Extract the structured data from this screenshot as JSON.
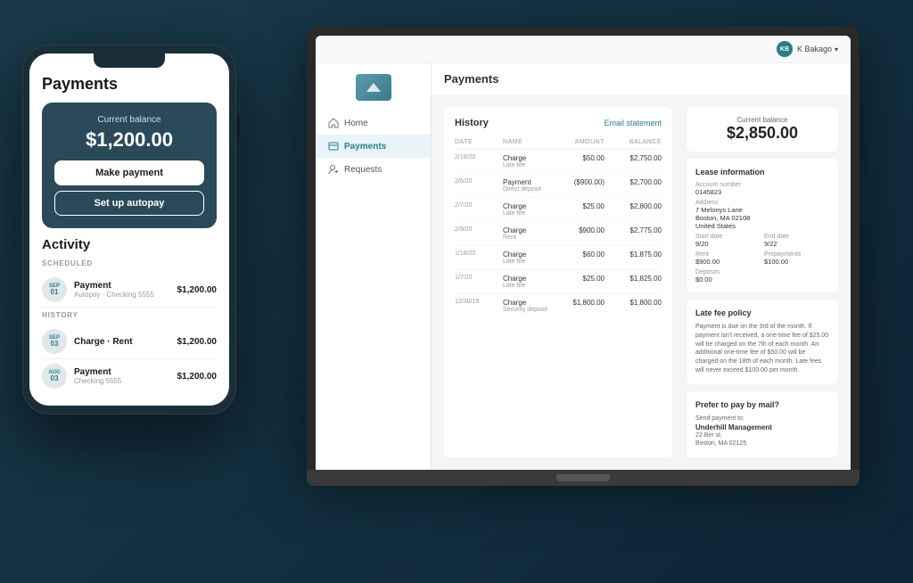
{
  "user": {
    "initials": "KB",
    "name": "K Bakago",
    "badge_label": "KB"
  },
  "sidebar": {
    "nav_items": [
      {
        "label": "Home",
        "icon": "home-icon",
        "active": false
      },
      {
        "label": "Payments",
        "icon": "payments-icon",
        "active": true
      },
      {
        "label": "Requests",
        "icon": "requests-icon",
        "active": false
      }
    ]
  },
  "laptop": {
    "page_title": "Payments",
    "history": {
      "title": "History",
      "email_link": "Email statement",
      "columns": [
        "DATE",
        "NAME",
        "AMOUNT",
        "BALANCE"
      ],
      "rows": [
        {
          "date": "2/18/20",
          "name": "Charge",
          "sub": "Late fee",
          "amount": "$50.00",
          "balance": "$2,750.00"
        },
        {
          "date": "2/6/20",
          "name": "Payment",
          "sub": "Direct deposit",
          "amount": "($900.00)",
          "balance": "$2,700.00"
        },
        {
          "date": "2/7/20",
          "name": "Charge",
          "sub": "Late fee",
          "amount": "$25.00",
          "balance": "$2,800.00"
        },
        {
          "date": "2/9/20",
          "name": "Charge",
          "sub": "Rent",
          "amount": "$900.00",
          "balance": "$2,775.00"
        },
        {
          "date": "1/18/20",
          "name": "Charge",
          "sub": "Late fee",
          "amount": "$60.00",
          "balance": "$1,875.00"
        },
        {
          "date": "1/7/20",
          "name": "Charge",
          "sub": "Late fee",
          "amount": "$25.00",
          "balance": "$1,825.00"
        },
        {
          "date": "12/30/19",
          "name": "Charge",
          "sub": "Security deposit",
          "amount": "$1,800.00",
          "balance": "$1,800.00"
        }
      ]
    },
    "balance": {
      "label": "Current balance",
      "amount": "$2,850.00"
    },
    "lease": {
      "title": "Lease information",
      "account_label": "Account number",
      "account_value": "0145823",
      "address_label": "Address",
      "address_value": "7 Melonys Lane\nBoston, MA 02108\nUnited States",
      "start_label": "Start date",
      "start_value": "9/20",
      "end_label": "End date",
      "end_value": "9/22",
      "rent_label": "Rent",
      "rent_value": "$900.00",
      "prepayments_label": "Prepayments",
      "prepayments_value": "$100.00",
      "deposits_label": "Deposits",
      "deposits_value": "$0.00"
    },
    "late_fee": {
      "title": "Late fee policy",
      "text": "Payment is due on the 3rd of the month. If payment isn't received, a one-time fee of $25.00 will be charged on the 7th of each month. An additional one-time fee of $50.00 will be charged on the 18th of each month. Late fees will never exceed $100.00 per month."
    },
    "mail": {
      "title": "Prefer to pay by mail?",
      "subtitle": "Send payment to:",
      "name": "Underhill Management",
      "address": "22 Birr st.\nBoston, MA 02125"
    }
  },
  "phone": {
    "page_title": "Payments",
    "balance": {
      "label": "Current balance",
      "amount": "$1,200.00"
    },
    "buttons": {
      "make_payment": "Make payment",
      "setup_autopay": "Set up autopay"
    },
    "activity": {
      "title": "Activity",
      "scheduled_label": "SCHEDULED",
      "history_label": "HISTORY",
      "scheduled_items": [
        {
          "month": "SEP",
          "day": "01",
          "name": "Payment",
          "sub": "Autopay · Checking 5555",
          "amount": "$1,200.00"
        }
      ],
      "history_items": [
        {
          "month": "SEP",
          "day": "03",
          "name": "Charge · Rent",
          "sub": "",
          "amount": "$1,200.00"
        },
        {
          "month": "AUG",
          "day": "03",
          "name": "Payment",
          "sub": "Checking 5555",
          "amount": "$1,200.00"
        }
      ]
    }
  }
}
